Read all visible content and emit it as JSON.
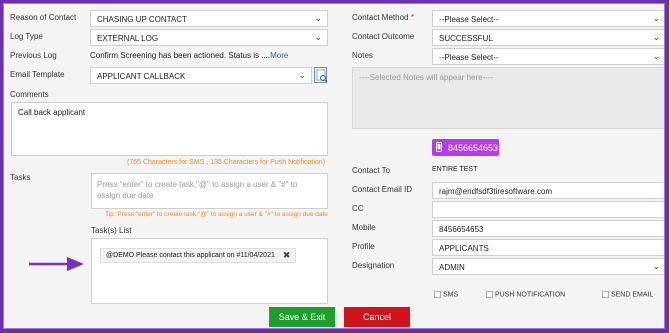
{
  "left": {
    "reason_label": "Reason of Contact",
    "reason_value": "CHASING UP CONTACT",
    "logtype_label": "Log Type",
    "logtype_value": "EXTERNAL LOG",
    "prevlog_label": "Previous Log",
    "prevlog_text": "Confirm Screening has been actioned. Status is ....",
    "prevlog_more": "More",
    "template_label": "Email Template",
    "template_value": "APPLICANT CALLBACK",
    "comments_label": "Comments",
    "comments_value": "Call back applicant",
    "char_counter": "(765 Characters for SMS , 135 Characters for Push Notification)",
    "tasks_label": "Tasks",
    "tasks_placeholder": "Press \"enter\" to create task,\"@\" to assign a user & \"#\" to assign due date",
    "tasks_tip": "Tip: Press \"enter\" to create task,\"@\" to assign a user & \"#\" to assign due date",
    "tasklist_label": "Task(s) List",
    "task_chip": "@DEMO Please contact this applicant on #11/04/2021"
  },
  "right": {
    "method_label": "Contact Method",
    "method_required": "*",
    "method_value": "--Please Select--",
    "outcome_label": "Contact Outcome",
    "outcome_value": "SUCCESSFUL",
    "notes_label": "Notes",
    "notes_value": "--Please Select--",
    "notes_placeholder": "----Selected Notes will appear here----",
    "phone_badge": "8456654653",
    "contactto_label": "Contact To",
    "contactto_value": "ENTIRE TEST",
    "email_label": "Contact Email ID",
    "email_value": "rajm@endfsdf3tiresoftware.com",
    "cc_label": "CC",
    "cc_value": "",
    "mobile_label": "Mobile",
    "mobile_value": "8456654653",
    "profile_label": "Profile",
    "profile_value": "APPLICANTS",
    "designation_label": "Designation",
    "designation_value": "ADMIN",
    "sms_label": "SMS",
    "push_label": "PUSH NOTIFICATION",
    "sendemail_label": "SEND EMAIL"
  },
  "buttons": {
    "save": "Save & Exit",
    "cancel": "Cancel"
  },
  "colors": {
    "save_bg": "#1e9e2a",
    "cancel_bg": "#d1141b",
    "badge_bg": "#b23ee8",
    "border": "#6a2fb3",
    "link": "#1f64c4"
  },
  "icons": [
    "chevron-down-icon",
    "template-preview-icon",
    "close-icon",
    "phone-icon",
    "arrow-icon"
  ]
}
